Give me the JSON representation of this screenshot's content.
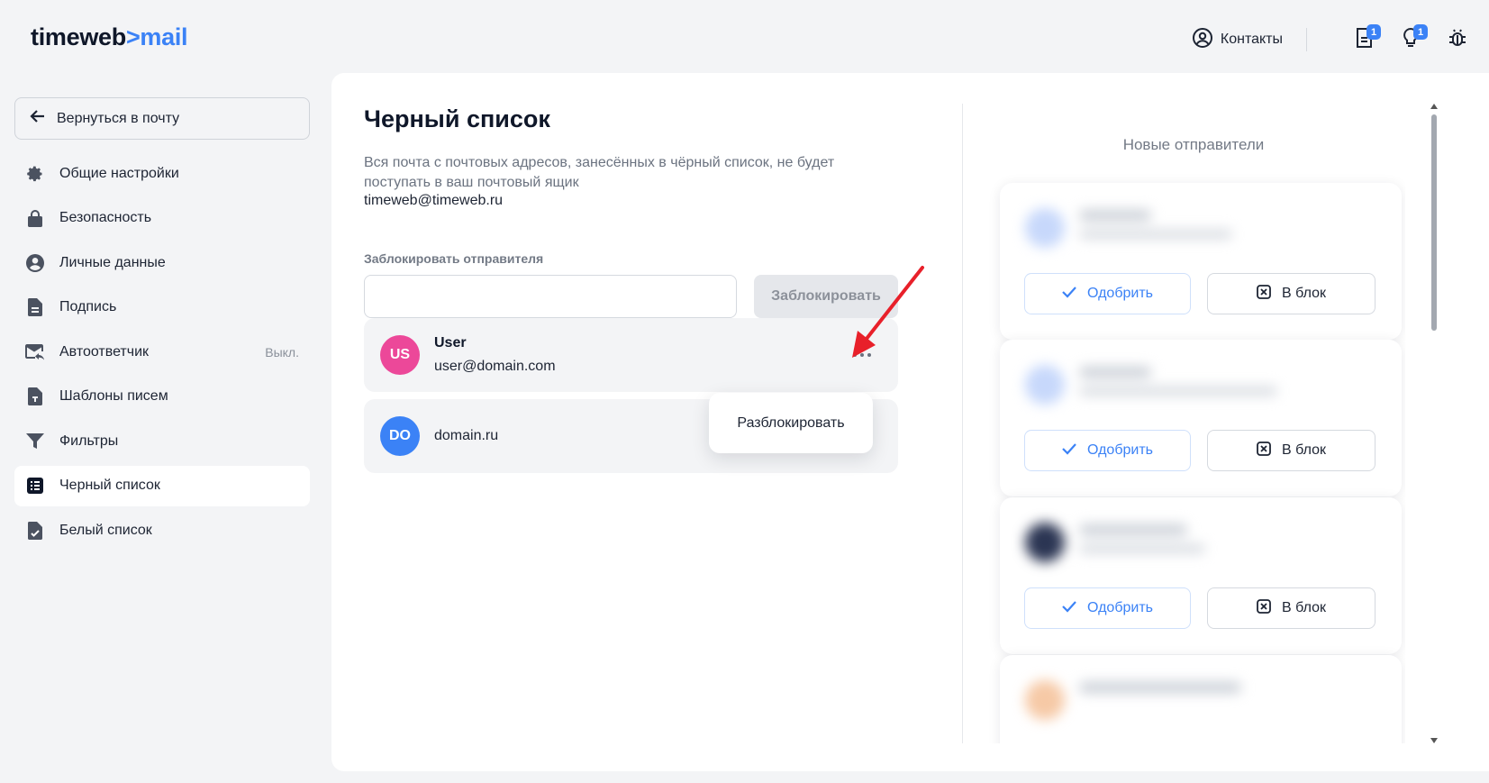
{
  "header": {
    "logo_part1": "timeweb",
    "logo_arrow": ">",
    "logo_part2": "mail",
    "contacts_label": "Контакты",
    "icons": [
      {
        "name": "document-icon",
        "badge": "1"
      },
      {
        "name": "lightbulb-icon",
        "badge": "1"
      },
      {
        "name": "bug-icon",
        "badge": ""
      }
    ]
  },
  "sidebar": {
    "back_label": "Вернуться в почту",
    "items": [
      {
        "label": "Общие настройки",
        "icon": "gear-icon",
        "status": ""
      },
      {
        "label": "Безопасность",
        "icon": "lock-icon",
        "status": ""
      },
      {
        "label": "Личные данные",
        "icon": "user-circle-icon",
        "status": ""
      },
      {
        "label": "Подпись",
        "icon": "signature-document-icon",
        "status": ""
      },
      {
        "label": "Автоответчик",
        "icon": "mail-reply-icon",
        "status": "Выкл."
      },
      {
        "label": "Шаблоны писем",
        "icon": "template-document-icon",
        "status": ""
      },
      {
        "label": "Фильтры",
        "icon": "filter-icon",
        "status": ""
      },
      {
        "label": "Черный список",
        "icon": "list-icon",
        "status": "",
        "active": true
      },
      {
        "label": "Белый список",
        "icon": "check-document-icon",
        "status": ""
      }
    ]
  },
  "main": {
    "title": "Черный список",
    "description": "Вся почта с почтовых адресов, занесённых в чёрный список, не будет поступать в ваш почтовый ящик",
    "account_email": "timeweb@timeweb.ru",
    "block_label": "Заблокировать отправителя",
    "block_input_value": "",
    "block_input_placeholder": "",
    "block_button": "Заблокировать",
    "entries": [
      {
        "initials": "US",
        "name": "User",
        "email": "user@domain.com",
        "color": "#ec4899"
      },
      {
        "initials": "DO",
        "name": "",
        "email": "domain.ru",
        "color": "#3b82f6"
      }
    ],
    "dropdown_item": "Разблокировать"
  },
  "right_panel": {
    "title": "Новые отправители",
    "approve_label": "Одобрить",
    "block_label": "В блок"
  },
  "colors": {
    "accent": "#3b82f6",
    "arrow": "#e8202a",
    "background": "#f3f4f6"
  }
}
